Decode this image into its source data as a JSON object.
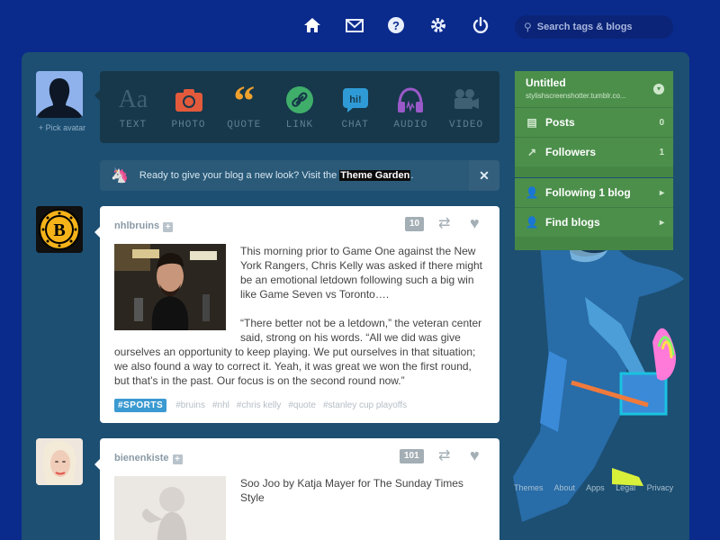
{
  "nav": {
    "icons": [
      "home-icon",
      "mail-icon",
      "help-icon",
      "gear-icon",
      "power-icon"
    ],
    "search_placeholder": "Search tags & blogs"
  },
  "composer": {
    "pick_avatar": "+ Pick avatar",
    "types": [
      {
        "label": "TEXT",
        "icon": "text-icon",
        "color": "#5a7385"
      },
      {
        "label": "PHOTO",
        "icon": "camera-icon",
        "color": "#e25a3c"
      },
      {
        "label": "QUOTE",
        "icon": "quote-icon",
        "color": "#f0a12d"
      },
      {
        "label": "LINK",
        "icon": "link-icon",
        "color": "#3fae6a"
      },
      {
        "label": "CHAT",
        "icon": "chat-icon",
        "color": "#2f9bd6"
      },
      {
        "label": "AUDIO",
        "icon": "headphones-icon",
        "color": "#9a59c8"
      },
      {
        "label": "VIDEO",
        "icon": "video-camera-icon",
        "color": "#5c7384"
      }
    ]
  },
  "notice": {
    "text": "Ready to give your blog a new look? Visit the ",
    "link": "Theme Garden",
    "after": ".",
    "close": "✕"
  },
  "posts": [
    {
      "author": "nhlbruins",
      "notes": "10",
      "paragraph1": "This morning prior to Game One against the New York Rangers, Chris Kelly was asked if there might be an emotional letdown following such a big win like Game Seven vs Toronto….",
      "paragraph2": "“There better not be a letdown,” the veteran center said, strong on his words. “All we did was give ourselves an opportunity to keep playing.  We put ourselves in that situation; we also found a way to correct it.  Yeah, it was great we won the first round, but that’s in the past. Our focus is on the second round now.”",
      "badge": "#SPORTS",
      "tags": [
        "#bruins",
        "#nhl",
        "#chris kelly",
        "#quote",
        "#stanley cup playoffs"
      ]
    },
    {
      "author": "bienenkiste",
      "notes": "101",
      "paragraph1": "Soo Joo by Katja Mayer for The Sunday Times Style"
    }
  ],
  "sidebar": {
    "blog_title": "Untitled",
    "blog_url": "stylishscreenshotter.tumblr.co...",
    "posts_label": "Posts",
    "posts_count": "0",
    "followers_label": "Followers",
    "followers_count": "1",
    "following_label": "Following 1 blog",
    "find_label": "Find blogs"
  },
  "footer": [
    "Themes",
    "About",
    "Apps",
    "Legal",
    "Privacy"
  ],
  "colors": {
    "background": "#0a2a8c",
    "panel": "#1d4f72",
    "sidebar": "#4c8f4b",
    "tag_badge": "#3b9ad1"
  }
}
